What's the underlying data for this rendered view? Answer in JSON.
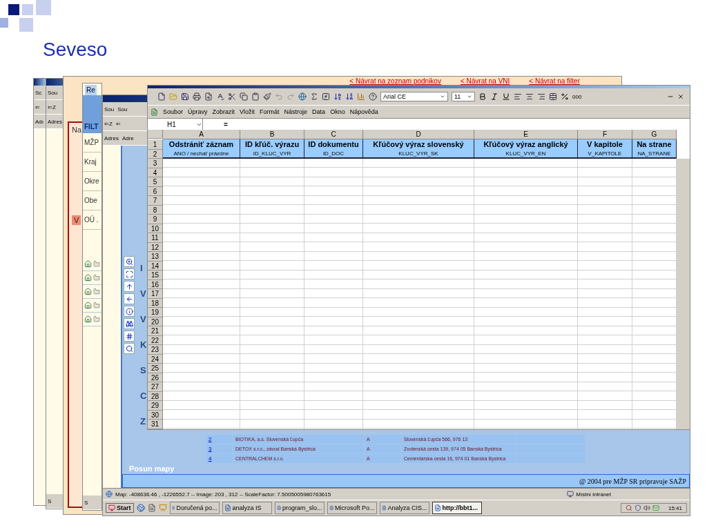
{
  "slide": {
    "title": "Seveso"
  },
  "back_windows": [
    {
      "menu": "Sc",
      "nav": "⇐",
      "address": "Adı"
    },
    {
      "menu": "Sou",
      "nav": "⇐Z",
      "address": "Adres",
      "task": "S"
    }
  ],
  "filter_page": {
    "links": [
      "< Návrat na zoznam podnikov",
      "< Návrat na VNI",
      "< Návrat na filter"
    ],
    "heading": "Na",
    "tab": "V"
  },
  "filter_window": {
    "tab": "Re",
    "title": "FILT",
    "items": [
      "MŽP",
      "Kraj",
      "Okre",
      "Obe",
      "OÚ ."
    ],
    "task": "S"
  },
  "map_window": {
    "menus": [
      "Sou",
      "Sou"
    ],
    "navs": [
      "⇐Z",
      "⇐"
    ],
    "addresses": [
      "Adres",
      "Adre"
    ],
    "labels": [
      "I",
      "V",
      "V",
      "K",
      "S",
      "C",
      "Z"
    ],
    "rows": [
      {
        "number": "2",
        "name": "BIOTIKA, a.s. Slovenská Ľupča",
        "type": "A",
        "address": "Slovenská Ľupča 566, 976 13"
      },
      {
        "number": "3",
        "name": "DETOX s.r.o., závod Banská Bystrica",
        "type": "A",
        "address": "Zvolenská cesta 139, 974 05 Banská Bystrica"
      },
      {
        "number": "4",
        "name": "CENTRALCHEM s.r.o.",
        "type": "A",
        "address": "Cementárska cesta 16, 974 01 Banská Bystrica"
      }
    ],
    "pan_label": "Posun mapy",
    "footer": "@ 2004 pre MŽP SR pripravuje SAŽP",
    "status": "Map: -408636.46 , -1226552.7 -- Image: 203 , 312 -- ScaleFactor: 7.5005005980763615",
    "zone": "Místní intranet"
  },
  "taskbar": {
    "start": "Start",
    "items": [
      {
        "label": "Doručená po...",
        "selected": false
      },
      {
        "label": "analyza IS",
        "selected": false
      },
      {
        "label": "program_slo...",
        "selected": false
      },
      {
        "label": "Microsoft Po...",
        "selected": false
      },
      {
        "label": "Analyza CIS...",
        "selected": false
      },
      {
        "label": "http://bbt1...",
        "selected": true
      }
    ],
    "clock": "15:41"
  },
  "excel": {
    "font": "Arial CE",
    "size": "11",
    "thousands": "000",
    "menu": [
      "Soubor",
      "Úpravy",
      "Zobrazit",
      "Vložit",
      "Formát",
      "Nástroje",
      "Data",
      "Okno",
      "Nápověda"
    ],
    "name_box": "H1",
    "formula_label": "=",
    "columns": [
      {
        "letter": "A",
        "title": "Odstrániť záznam",
        "field": "ANO / nechať prázdne"
      },
      {
        "letter": "B",
        "title": "ID kľúč. výrazu",
        "field": "ID_KLUC_VYR"
      },
      {
        "letter": "C",
        "title": "ID dokumentu",
        "field": "ID_DOC"
      },
      {
        "letter": "D",
        "title": "Kľúčový výraz slovenský",
        "field": "KLUC_VYR_SK"
      },
      {
        "letter": "E",
        "title": "Kľúčový výraz anglický",
        "field": "KLUC_VYR_EN"
      },
      {
        "letter": "F",
        "title": "V kapitole",
        "field": "V_KAPITOLE"
      },
      {
        "letter": "G",
        "title": "Na strane",
        "field": "NA_STRANE"
      }
    ],
    "header_rows": [
      "1",
      "2"
    ],
    "rows": [
      "3",
      "4",
      "5",
      "6",
      "7",
      "8",
      "9",
      "10",
      "11",
      "12",
      "13",
      "14",
      "15",
      "16",
      "17",
      "18",
      "19",
      "20",
      "21",
      "22",
      "23",
      "24",
      "25",
      "26",
      "27",
      "28",
      "29",
      "30",
      "31"
    ]
  }
}
